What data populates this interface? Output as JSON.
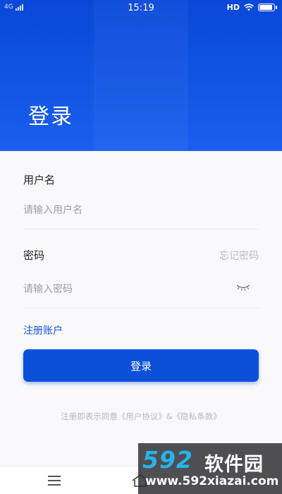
{
  "status_bar": {
    "network": "4G",
    "time": "15:19",
    "hd": "HD",
    "battery_level": 0.9
  },
  "header": {
    "title": "登录",
    "background_color": "#1256e4"
  },
  "form": {
    "username": {
      "label": "用户名",
      "placeholder": "请输入用户名"
    },
    "password": {
      "label": "密码",
      "placeholder": "请输入密码",
      "forgot_link": "忘记密码",
      "toggle_icon": "eye-closed-icon"
    },
    "register_link": "注册账户",
    "login_button": "登录",
    "agreement": "注册即表示同意《用户协议》&《隐私条款》"
  },
  "nav_bar": {
    "menu_icon": "menu-icon",
    "home_icon": "home-icon"
  },
  "watermark": {
    "logo": "592",
    "text": "软件园",
    "url": "www.592xiazai.com"
  },
  "colors": {
    "accent": "#0c4fd9",
    "link": "#1656d8",
    "placeholder": "#9aa0a8"
  }
}
